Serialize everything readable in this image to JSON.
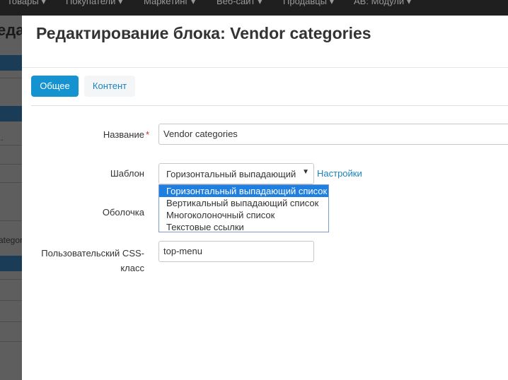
{
  "background": {
    "nav": [
      "Товары ▾",
      "Покупатели ▾",
      "Маркетинг ▾",
      "Веб-сайт ▾",
      "Продавцы ▾",
      "AB: Модули ▾"
    ],
    "heading": "еда",
    "fragment_1": "..",
    "fragment_2": "ategor"
  },
  "modal": {
    "title": "Редактирование блока: Vendor categories",
    "tabs": [
      {
        "label": "Общее"
      },
      {
        "label": "Контент"
      }
    ],
    "fields": {
      "name": {
        "label": "Название",
        "required_mark": "*",
        "value": "Vendor categories"
      },
      "template": {
        "label": "Шаблон",
        "value": "Горизонтальный выпадающий",
        "settings_link": "Настройки",
        "options": [
          "Горизонтальный выпадающий список",
          "Вертикальный выпадающий список",
          "Многоколоночный список",
          "Текстовые ссылки"
        ],
        "selected_index": 0
      },
      "wrapper": {
        "label": "Оболочка"
      },
      "css_class": {
        "label_line1": "Пользовательский CSS-",
        "label_line2": "класс",
        "value": "top-menu"
      }
    }
  },
  "colors": {
    "primary": "#1592d0",
    "link": "#1a83bd",
    "required": "#cc2a2a",
    "highlight": "#1e7fe0"
  }
}
